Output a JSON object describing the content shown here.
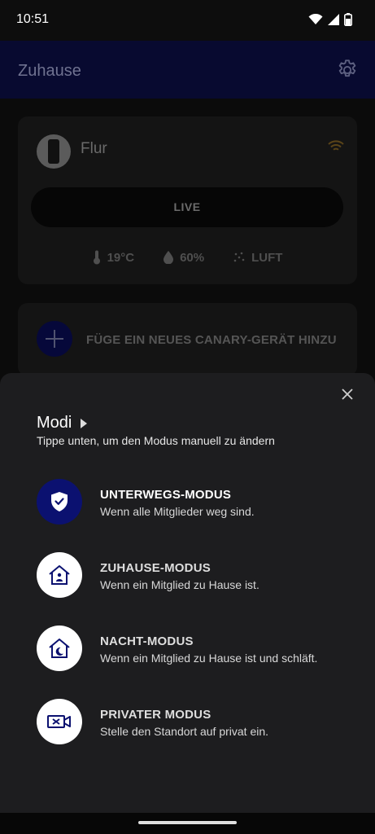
{
  "status_bar": {
    "time": "10:51",
    "icons": [
      "wifi-icon",
      "signal-icon",
      "battery-icon"
    ]
  },
  "app_bar": {
    "title": "Zuhause",
    "settings_icon": "gear-icon"
  },
  "device_card": {
    "name": "Flur",
    "live_label": "LIVE",
    "stats": [
      {
        "icon": "thermometer-icon",
        "value": "19°C"
      },
      {
        "icon": "droplet-icon",
        "value": "60%"
      },
      {
        "icon": "air-quality-icon",
        "value": "LUFT"
      }
    ]
  },
  "add_device": {
    "label": "FÜGE EIN NEUES CANARY-GERÄT HINZU"
  },
  "sheet": {
    "title": "Modi",
    "subtitle": "Tippe unten, um den Modus manuell zu ändern",
    "modes": [
      {
        "title": "UNTERWEGS-MODUS",
        "description": "Wenn alle Mitglieder weg sind.",
        "icon": "shield-check-icon",
        "active": true
      },
      {
        "title": "ZUHAUSE-MODUS",
        "description": "Wenn ein Mitglied zu Hause ist.",
        "icon": "home-person-icon",
        "active": false
      },
      {
        "title": "NACHT-MODUS",
        "description": "Wenn ein Mitglied zu Hause ist und schläft.",
        "icon": "home-moon-icon",
        "active": false
      },
      {
        "title": "PRIVATER MODUS",
        "description": "Stelle den Standort auf privat ein.",
        "icon": "camera-off-icon",
        "active": false
      }
    ]
  },
  "colors": {
    "app_bar": "#080a30",
    "active_mode": "#0b1170",
    "sheet": "#1d1d1f",
    "icon_navy": "#0b1170"
  }
}
